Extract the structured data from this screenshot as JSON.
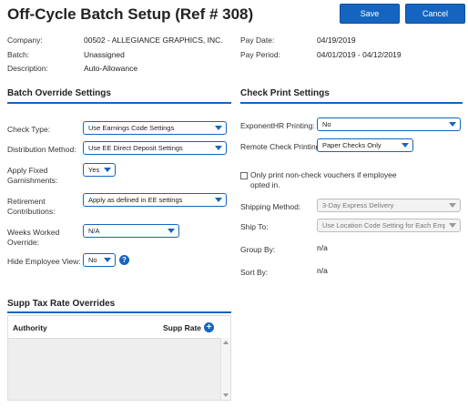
{
  "header": {
    "title": "Off-Cycle Batch Setup (Ref # 308)",
    "save_label": "Save",
    "cancel_label": "Cancel"
  },
  "info": {
    "company_label": "Company:",
    "company_value": "00502 - ALLEGIANCE GRAPHICS, INC.",
    "batch_label": "Batch:",
    "batch_value": "Unassigned",
    "description_label": "Description:",
    "description_value": "Auto-Allowance",
    "pay_date_label": "Pay Date:",
    "pay_date_value": "04/19/2019",
    "pay_period_label": "Pay Period:",
    "pay_period_value": "04/01/2019 - 04/12/2019"
  },
  "batch_override": {
    "title": "Batch Override Settings",
    "check_type_label": "Check Type:",
    "check_type_value": "Use Earnings Code Settings",
    "distribution_label": "Distribution Method:",
    "distribution_value": "Use EE Direct Deposit Settings",
    "garnish_label_1": "Apply Fixed",
    "garnish_label_2": "Garnishments:",
    "garnish_value": "Yes",
    "retirement_label_1": "Retirement",
    "retirement_label_2": "Contributions:",
    "retirement_value": "Apply as defined in EE settings",
    "weeks_label_1": "Weeks Worked",
    "weeks_label_2": "Override:",
    "weeks_value": "N/A",
    "hide_label": "Hide Employee View:",
    "hide_value": "No",
    "help_glyph": "?"
  },
  "check_print": {
    "title": "Check Print Settings",
    "exponent_label": "ExponentHR Printing:",
    "exponent_value": "No",
    "remote_label": "Remote Check Printing:",
    "remote_value": "Paper Checks Only",
    "only_print_line1": "Only print non-check vouchers if employee",
    "only_print_line2": "opted in.",
    "shipping_label": "Shipping Method:",
    "shipping_value": "3-Day Express Delivery",
    "ship_to_label": "Ship To:",
    "ship_to_value": "Use Location Code Setting for Each Employee",
    "group_by_label": "Group By:",
    "group_by_value": "n/a",
    "sort_by_label": "Sort By:",
    "sort_by_value": "n/a"
  },
  "supp_tax": {
    "title": "Supp Tax Rate Overrides",
    "col_authority": "Authority",
    "col_supp_rate": "Supp Rate",
    "add_glyph": "+"
  },
  "colors": {
    "accent": "#1565c0"
  }
}
